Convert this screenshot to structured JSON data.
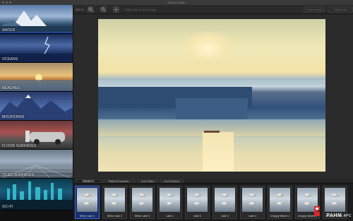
{
  "window": {
    "title": "Reflect Studio"
  },
  "toolbar": {
    "zoom": "100 %",
    "hint": "Right-click to drag image",
    "btn_open": "Save a copy",
    "btn_hide": "Hide Dual Mode"
  },
  "sidebar": {
    "items": [
      {
        "label": "WATER"
      },
      {
        "label": "OCEANS"
      },
      {
        "label": "BEACHES"
      },
      {
        "label": "MOUNTAINS"
      },
      {
        "label": "FLOOR SURFACES"
      },
      {
        "label": "TILED SURFACES"
      },
      {
        "label": "SCI-FI"
      }
    ]
  },
  "tabs": [
    {
      "label": "PRESETS"
    },
    {
      "label": "Reflect Properties"
    },
    {
      "label": "Lens Filters"
    },
    {
      "label": "Lens Textures"
    }
  ],
  "presets": [
    {
      "label": "Mirror Lake 1"
    },
    {
      "label": "Mirror Lake 2"
    },
    {
      "label": "Mirror Lake 3"
    },
    {
      "label": "Lake 1"
    },
    {
      "label": "Lake 2"
    },
    {
      "label": "Lake 3"
    },
    {
      "label": "Lake 4"
    },
    {
      "label": "Choppy Waves 1"
    },
    {
      "label": "Choppy Waves 2"
    },
    {
      "label": "Choppy Waves 3"
    }
  ],
  "watermark": {
    "text": "PAHM",
    "sub": "4PC"
  },
  "colors": {
    "accent": "#3b66d1",
    "background": "#1e1e1e"
  }
}
